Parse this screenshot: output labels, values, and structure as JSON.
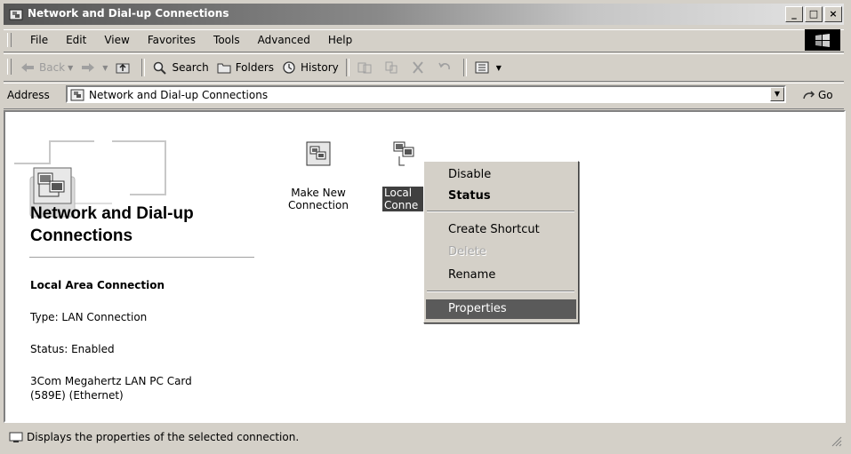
{
  "window": {
    "title": "Network and Dial-up Connections",
    "controls": {
      "minimize": "_",
      "maximize": "□",
      "close": "×"
    }
  },
  "menubar": {
    "items": [
      "File",
      "Edit",
      "View",
      "Favorites",
      "Tools",
      "Advanced",
      "Help"
    ]
  },
  "toolbar": {
    "back": "Back",
    "search": "Search",
    "folders": "Folders",
    "history": "History"
  },
  "address": {
    "label": "Address",
    "value": "Network and Dial-up Connections",
    "go": "Go"
  },
  "webview": {
    "title": "Network and Dial-up Connections",
    "details": {
      "name": "Local Area Connection",
      "type": "Type: LAN Connection",
      "status": "Status: Enabled",
      "device_line1": "3Com Megahertz LAN PC Card",
      "device_line2": "(589E) (Ethernet)"
    }
  },
  "items": [
    {
      "line1": "Make New",
      "line2": "Connection",
      "icon": "make-new-connection-icon"
    },
    {
      "line1": "Local",
      "line2": "Conne",
      "icon": "lan-connection-icon",
      "selected": true
    }
  ],
  "context_menu": {
    "disable": "Disable",
    "status": "Status",
    "create_shortcut": "Create Shortcut",
    "delete": "Delete",
    "rename": "Rename",
    "properties": "Properties"
  },
  "statusbar": {
    "text": "Displays the properties of the selected connection."
  }
}
